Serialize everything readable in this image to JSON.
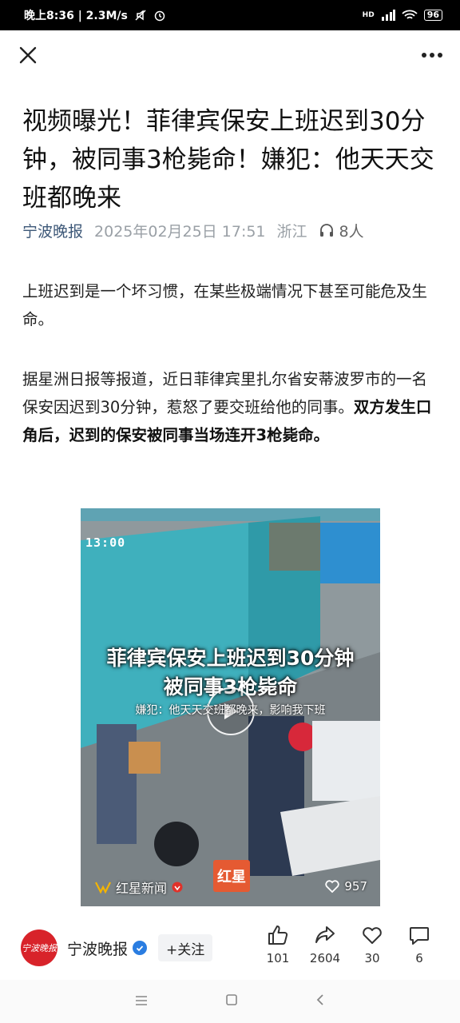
{
  "status_bar": {
    "time_speed": "晚上8:36 | 2.3M/s",
    "network": "HD",
    "battery": "96"
  },
  "article": {
    "title": "视频曝光！菲律宾保安上班迟到30分钟，被同事3枪毙命！嫌犯：他天天交班都晚来",
    "source": "宁波晚报",
    "date": "2025年02月25日 17:51",
    "location": "浙江",
    "listeners": "8人",
    "paragraph1": "上班迟到是一个坏习惯，在某些极端情况下甚至可能危及生命。",
    "paragraph2": "据星洲日报等报道，近日菲律宾里扎尔省安蒂波罗市的一名保安因迟到30分钟，惹怒了要交班给他的同事。",
    "paragraph2_bold": "双方发生口角后，迟到的保安被同事当场连开3枪毙命。"
  },
  "video": {
    "timestamp": "13:00",
    "headline_line1": "菲律宾保安上班迟到30分钟",
    "headline_line2": "被同事3枪毙命",
    "subtitle": "嫌犯：他天天交班都晚来，影响我下班",
    "brand": "红星新闻",
    "badge": "红星",
    "likes": "957"
  },
  "bottom_bar": {
    "avatar_text": "宁波晚报",
    "author": "宁波晚报",
    "follow_label": "+关注",
    "actions": [
      {
        "icon": "thumbs-up-icon",
        "count": "101"
      },
      {
        "icon": "share-icon",
        "count": "2604"
      },
      {
        "icon": "heart-icon",
        "count": "30"
      },
      {
        "icon": "comment-icon",
        "count": "6"
      }
    ]
  }
}
